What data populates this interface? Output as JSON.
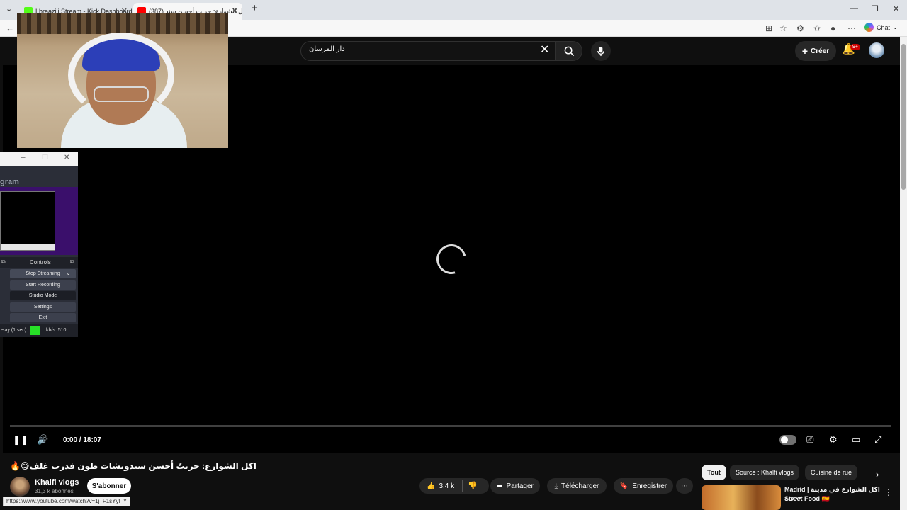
{
  "browser": {
    "tabs": [
      {
        "title": "Lbraazili Stream - Kick Dashboard",
        "favicon_color": "#53fc18"
      },
      {
        "title": "(387) اكل الشوارع: جربت أحسن سند...",
        "favicon_color": "#ff0000"
      }
    ],
    "chat_label": "Chat"
  },
  "youtube": {
    "search_value": "دار المرسان",
    "create_label": "Créer",
    "notification_badge": "9+",
    "player": {
      "time": "0:00 / 18:07"
    },
    "video_title": "🔥😋اكل الشوارع: جربتّ أحسن سندويشات طون فدرب غلف",
    "channel_name": "Khalfi vlogs",
    "subscribers": "31,3 k abonnés",
    "subscribe_label": "S'abonner",
    "like_count": "3,4 k",
    "share_label": "Partager",
    "download_label": "Télécharger",
    "save_label": "Enregistrer",
    "chips": [
      "Tout",
      "Source : Khalfi vlogs",
      "Cuisine de rue"
    ],
    "recommended": {
      "title_line1": "Madrid | اكل الشوارع في مدينة مدريد",
      "title_line2": "Street Food 🇪🇸"
    },
    "status_url": "https://www.youtube.com/watch?v=1j_F1sYyl_Y"
  },
  "obs": {
    "heading": "gram",
    "controls_label": "Controls",
    "buttons": [
      "Stop Streaming",
      "Start Recording",
      "Studio Mode",
      "Settings",
      "Exit"
    ],
    "delay": "elay (1 sec)",
    "kbs": "kb/s: 510",
    "status_color": "#27e027"
  }
}
